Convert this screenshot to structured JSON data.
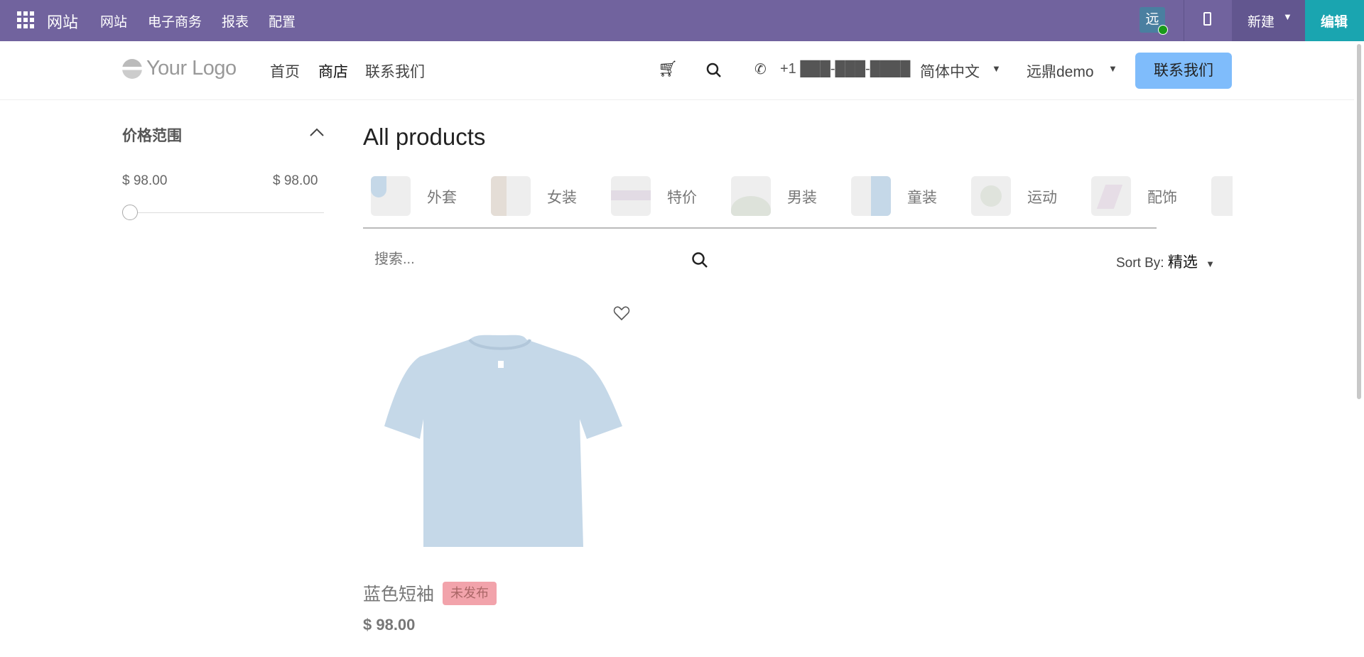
{
  "topbar": {
    "app": "网站",
    "menus": [
      "网站",
      "电子商务",
      "报表",
      "配置"
    ],
    "avatar": "远",
    "new_label": "新建",
    "edit_label": "编辑"
  },
  "header": {
    "logo": "Your Logo",
    "nav": [
      "首页",
      "商店",
      "联系我们"
    ],
    "phone": "+1 ███-███-████",
    "language": "简体中文",
    "user": "远鼎demo",
    "cta": "联系我们"
  },
  "sidebar": {
    "title": "价格范围",
    "min": "$ 98.00",
    "max": "$ 98.00",
    "slider_value": 0
  },
  "main": {
    "title": "All products",
    "categories": [
      "外套",
      "女装",
      "特价",
      "男装",
      "童装",
      "运动",
      "配饰"
    ],
    "search_placeholder": "搜索...",
    "sort_label": "Sort By:",
    "sort_value": "精选"
  },
  "products": [
    {
      "name": "蓝色短袖",
      "badge": "未发布",
      "price": "$ 98.00"
    }
  ],
  "colors": {
    "topbar": "#71639e",
    "edit": "#1aa5b0",
    "cta": "#7fbcfb",
    "badge": "#f2a3ab"
  }
}
